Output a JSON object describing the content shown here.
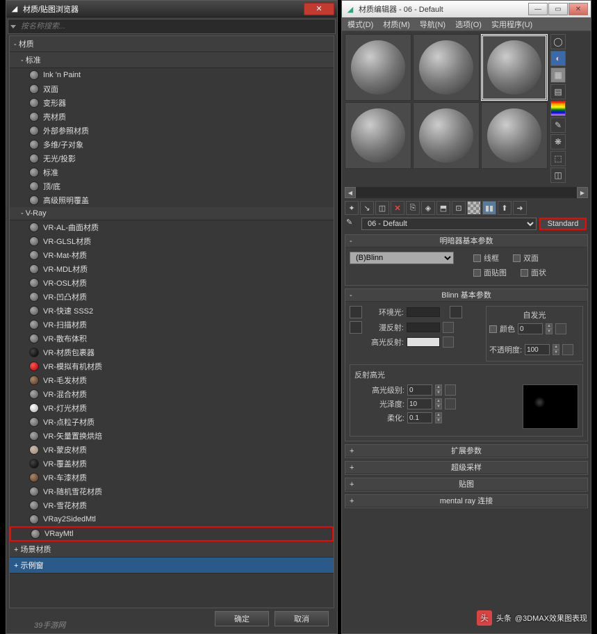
{
  "leftWindow": {
    "title": "材质/贴图浏览器",
    "searchPlaceholder": "按名称搜索...",
    "groups": {
      "materials": "- 材质",
      "standard": "- 标准",
      "vray": "- V-Ray",
      "scene": "+ 场景材质",
      "sample": "+ 示例窗"
    },
    "standardMats": [
      "Ink 'n Paint",
      "双面",
      "变形器",
      "壳材质",
      "外部参照材质",
      "多维/子对象",
      "无光/投影",
      "标准",
      "顶/底",
      "高级照明覆盖"
    ],
    "vrayMats": [
      "VR-AL-曲面材质",
      "VR-GLSL材质",
      "VR-Mat-材质",
      "VR-MDL材质",
      "VR-OSL材质",
      "VR-凹凸材质",
      "VR-快速 SSS2",
      "VR-扫描材质",
      "VR-散布体积",
      "VR-材质包裹器",
      "VR-模拟有机材质",
      "VR-毛发材质",
      "VR-混合材质",
      "VR-灯光材质",
      "VR-点粒子材质",
      "VR-矢量置换烘焙",
      "VR-蒙皮材质",
      "VR-覆盖材质",
      "VR-车漆材质",
      "VR-随机雪花材质",
      "VR-雪花材质",
      "VRay2SidedMtl",
      "VRayMtl"
    ],
    "okBtn": "确定",
    "cancelBtn": "取消"
  },
  "rightWindow": {
    "title": "材质编辑器 - 06 - Default",
    "menus": [
      "模式(D)",
      "材质(M)",
      "导航(N)",
      "选项(O)",
      "实用程序(U)"
    ],
    "matName": "06 - Default",
    "matType": "Standard",
    "rollouts": {
      "shader": "明暗器基本参数",
      "blinn": "Blinn 基本参数",
      "extended": "扩展参数",
      "supersample": "超级采样",
      "maps": "贴图",
      "mentalray": "mental ray 连接"
    },
    "shaderType": "(B)Blinn",
    "labels": {
      "wireframe": "线框",
      "twoSided": "双面",
      "faceMap": "面贴图",
      "faceted": "面状",
      "selfIllum": "自发光",
      "color": "颜色",
      "ambient": "环境光:",
      "diffuse": "漫反射:",
      "specular": "高光反射:",
      "opacity": "不透明度:",
      "specHighlights": "反射高光",
      "specLevel": "高光级别:",
      "gloss": "光泽度:",
      "soften": "柔化:"
    },
    "values": {
      "selfIllum": "0",
      "opacity": "100",
      "specLevel": "0",
      "gloss": "10",
      "soften": "0.1"
    }
  },
  "watermark": {
    "prefix": "头条",
    "text": "@3DMAX效果图表现",
    "small": "39手游网"
  }
}
